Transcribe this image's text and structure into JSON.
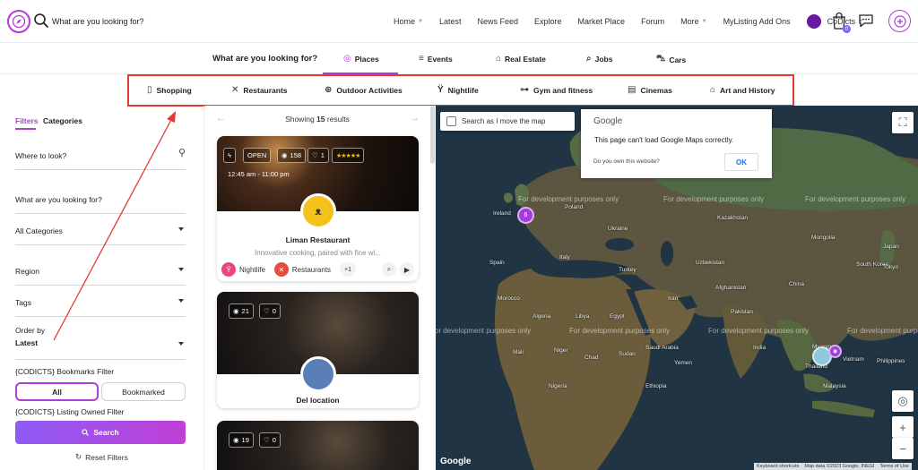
{
  "header": {
    "search_placeholder": "What are you looking for?",
    "nav": [
      {
        "label": "Home",
        "caret": true
      },
      {
        "label": "Latest"
      },
      {
        "label": "News Feed"
      },
      {
        "label": "Explore"
      },
      {
        "label": "Market Place"
      },
      {
        "label": "Forum"
      },
      {
        "label": "More",
        "caret": true
      },
      {
        "label": "MyListing Add Ons"
      }
    ],
    "user_name": "CoDicts",
    "cart_count": "0"
  },
  "types": {
    "question": "What are you looking for?",
    "tabs": [
      "Places",
      "Events",
      "Real Estate",
      "Jobs",
      "Cars"
    ],
    "active": "Places"
  },
  "categories": [
    "Shopping",
    "Restaurants",
    "Outdoor Activities",
    "Nightlife",
    "Gym and fitness",
    "Cinemas",
    "Art and History"
  ],
  "filters": {
    "tab_filters": "Filters",
    "tab_categories": "Categories",
    "where_label": "Where to look?",
    "what_label": "What are you looking for?",
    "all_categories": "All Categories",
    "region": "Region",
    "tags": "Tags",
    "order_label": "Order by",
    "order_value": "Latest",
    "bookmarks_label": "{CODICTS} Bookmarks Filter",
    "toggle_all": "All",
    "toggle_bookmarked": "Bookmarked",
    "owned_label": "{CODICTS} Listing Owned Filter",
    "search_button": "Search",
    "reset": "Reset Filters"
  },
  "results": {
    "showing_prefix": "Showing",
    "count": "15",
    "showing_suffix": "results",
    "cards": [
      {
        "status": "OPEN",
        "views": "158",
        "likes": "1",
        "hours": "12:45 am - 11:00 pm",
        "title": "Liman Restaurant",
        "subtitle": "Innovative cooking, paired with fine wi...",
        "tag1": "Nightlife",
        "tag2": "Restaurants",
        "more": "+1"
      },
      {
        "views": "21",
        "likes": "0",
        "title": "Del location"
      },
      {
        "views": "19",
        "likes": "0"
      }
    ]
  },
  "map": {
    "checkbox_label": "Search as I move the map",
    "google_brand": "Google",
    "error_message": "This page can't load Google Maps correctly.",
    "own_question": "Do you own this website?",
    "ok": "OK",
    "dev_text": "For development purposes only",
    "cluster_count": "6",
    "logo": "Google",
    "attribution": [
      "Keyboard shortcuts",
      "Map data ©2023 Google, INEGI",
      "Terms of Use"
    ],
    "labels": [
      "Ireland",
      "Poland",
      "Ukraine",
      "Kazakhstan",
      "Mongolia",
      "Spain",
      "Italy",
      "Turkey",
      "Uzbekistan",
      "Iran",
      "China",
      "Afghanistan",
      "Morocco",
      "Algeria",
      "Libya",
      "Egypt",
      "Saudi Arabia",
      "Pakistan",
      "India",
      "Myanmar",
      "Mali",
      "Niger",
      "Chad",
      "Sudan",
      "Yemen",
      "Ethiopia",
      "Nigeria",
      "Thailand",
      "Philippines",
      "Vietnam",
      "Malaysia",
      "Japan",
      "South Korea",
      "Tokyo"
    ]
  },
  "colors": {
    "accent": "#b23cd6",
    "annotation": "#e53935"
  }
}
